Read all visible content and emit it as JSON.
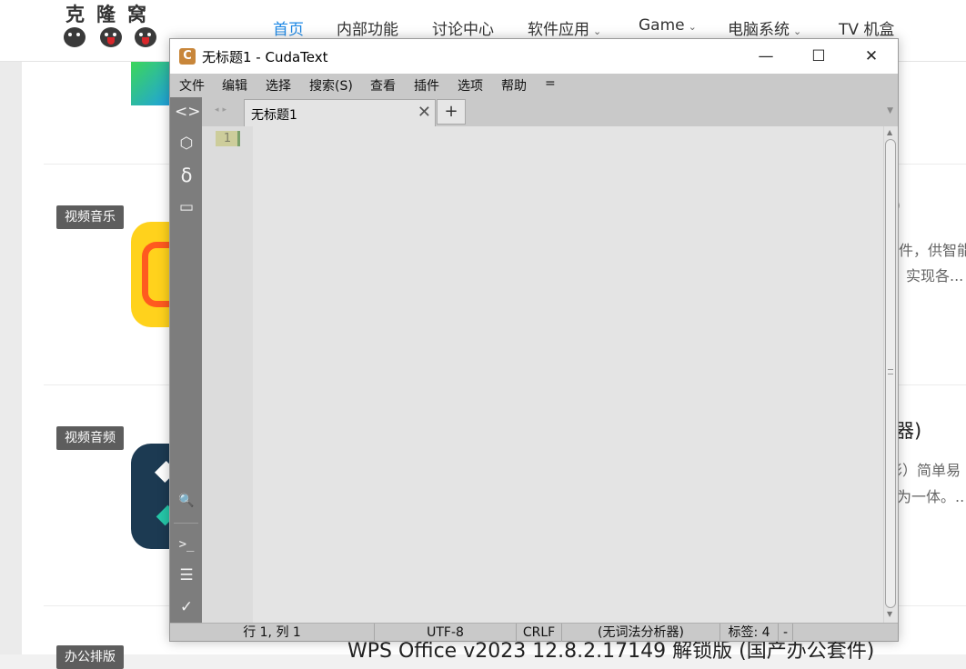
{
  "website": {
    "logo": {
      "text": "克隆窝"
    },
    "nav": [
      {
        "label": "首页",
        "active": true,
        "dropdown": false
      },
      {
        "label": "内部功能",
        "active": false,
        "dropdown": false
      },
      {
        "label": "讨论中心",
        "active": false,
        "dropdown": false
      },
      {
        "label": "软件应用",
        "active": false,
        "dropdown": true
      },
      {
        "label": "Game",
        "active": false,
        "dropdown": true
      },
      {
        "label": "电脑系统",
        "active": false,
        "dropdown": true
      },
      {
        "label": "TV 机盒",
        "active": false,
        "dropdown": false
      }
    ],
    "chevron": "⌄",
    "cards": [
      {
        "tag": "视频音乐",
        "title_fragment": ")",
        "desc_line1": "软件，供智能",
        "desc_line2": "，实现各..."
      },
      {
        "tag": "视频音频",
        "title_fragment": "器)",
        "desc_line1": "影）简单易",
        "desc_line2": "为一体。.."
      },
      {
        "tag": "办公排版",
        "title_fragment": "WPS Office v2023 12.8.2.17149 解锁版 (国产办公套件)"
      }
    ]
  },
  "window": {
    "app_icon_letter": "C",
    "title": "无标题1 - CudaText",
    "controls": {
      "minimize": "—",
      "maximize": "☐",
      "close": "✕"
    },
    "menu": [
      "文件",
      "编辑",
      "选择",
      "搜索(S)",
      "查看",
      "插件",
      "选项",
      "帮助",
      "="
    ],
    "sidebar": {
      "top_icons": [
        {
          "name": "code-tree-icon",
          "glyph": "<>"
        },
        {
          "name": "project-box-icon",
          "glyph": "⬡"
        },
        {
          "name": "snippets-delta-icon",
          "glyph": "δ"
        },
        {
          "name": "tabs-window-icon",
          "glyph": "▭"
        }
      ],
      "bottom_icons": [
        {
          "name": "search-icon",
          "glyph": "🔍"
        },
        {
          "name": "console-icon",
          "glyph": ">_"
        },
        {
          "name": "output-list-icon",
          "glyph": "☰"
        },
        {
          "name": "validate-check-icon",
          "glyph": "✓"
        }
      ]
    },
    "tabs": {
      "arrows": "◂▸",
      "active_tab": "无标题1",
      "close_glyph": "✕",
      "add_glyph": "+",
      "menu_glyph": "▼"
    },
    "editor": {
      "line_numbers": [
        "1"
      ],
      "content": ""
    },
    "status": {
      "position": "行 1, 列 1",
      "encoding": "UTF-8",
      "line_ending": "CRLF",
      "lexer": "(无词法分析器)",
      "tab_size": "标签: 4",
      "extra": "-"
    },
    "colors": {
      "chrome_gray": "#c9c9c9",
      "sidebar_gray": "#7d7d7d",
      "editor_bg": "#e4e4e4",
      "accent_blue": "#1e88e5"
    }
  }
}
